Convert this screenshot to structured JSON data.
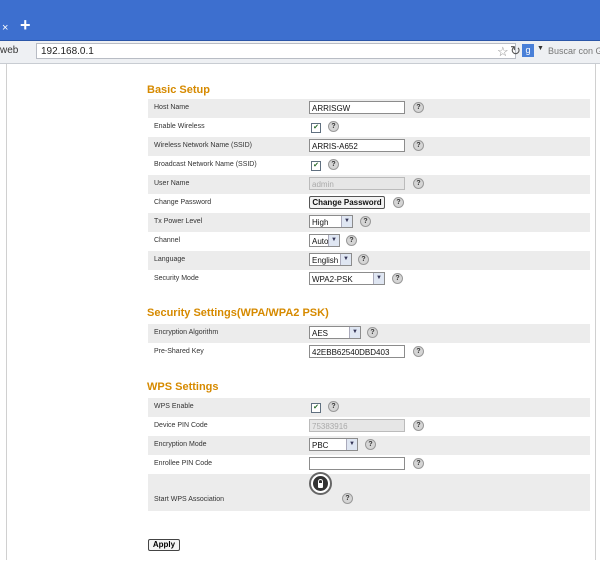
{
  "browser": {
    "source_label": "web",
    "url": "192.168.0.1",
    "search_placeholder": "Buscar con G",
    "search_engine_letter": "g"
  },
  "basic_setup": {
    "title": "Basic Setup",
    "host_name_label": "Host Name",
    "host_name_value": "ARRISGW",
    "enable_wireless_label": "Enable Wireless",
    "enable_wireless_checked": true,
    "ssid_label": "Wireless Network Name (SSID)",
    "ssid_value": "ARRIS-A652",
    "broadcast_label": "Broadcast Network Name (SSID)",
    "broadcast_checked": true,
    "user_name_label": "User Name",
    "user_name_value": "admin",
    "change_password_label": "Change Password",
    "change_password_button": "Change Password",
    "tx_power_label": "Tx Power Level",
    "tx_power_value": "High",
    "channel_label": "Channel",
    "channel_value": "Auto",
    "language_label": "Language",
    "language_value": "English",
    "security_mode_label": "Security Mode",
    "security_mode_value": "WPA2-PSK"
  },
  "security_settings": {
    "title": "Security Settings(WPA/WPA2 PSK)",
    "encryption_label": "Encryption Algorithm",
    "encryption_value": "AES",
    "psk_label": "Pre-Shared Key",
    "psk_value": "42EBB62540DBD403"
  },
  "wps_settings": {
    "title": "WPS Settings",
    "wps_enable_label": "WPS Enable",
    "wps_enable_checked": true,
    "device_pin_label": "Device PIN Code",
    "device_pin_value": "75383916",
    "encryption_mode_label": "Encryption Mode",
    "encryption_mode_value": "PBC",
    "enrollee_pin_label": "Enrollee PIN Code",
    "enrollee_pin_value": "",
    "start_wps_label": "Start WPS Association"
  },
  "apply_button": "Apply",
  "help_glyph": "?",
  "check_glyph": "✔"
}
